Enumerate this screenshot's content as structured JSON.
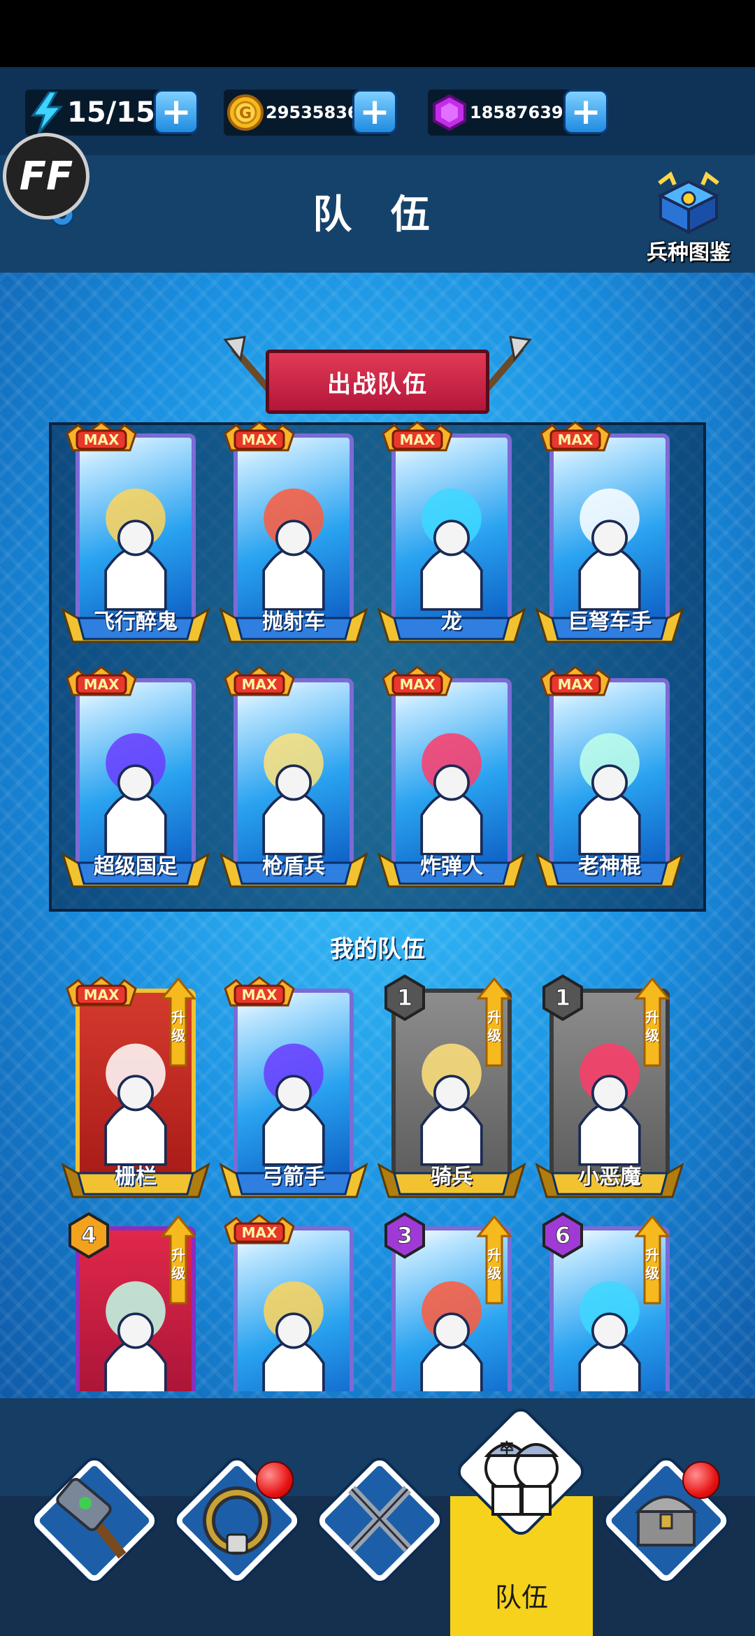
{
  "resources": {
    "energy": {
      "icon": "lightning-icon",
      "value": "15/15"
    },
    "gold": {
      "icon": "gold-coin-icon",
      "value": "29535836"
    },
    "gems": {
      "icon": "purple-gem-icon",
      "value": "18587639"
    },
    "plus_symbol": "+"
  },
  "header": {
    "ff_button": "FF",
    "title": "队 伍",
    "codex_label": "兵种图鉴"
  },
  "battle_team": {
    "ribbon_label": "出战队伍",
    "cards": [
      {
        "name": "飞行醉鬼",
        "badge": "MAX"
      },
      {
        "name": "抛射车",
        "badge": "MAX"
      },
      {
        "name": "龙",
        "badge": "MAX"
      },
      {
        "name": "巨弩车手",
        "badge": "MAX"
      },
      {
        "name": "超级国足",
        "badge": "MAX"
      },
      {
        "name": "枪盾兵",
        "badge": "MAX"
      },
      {
        "name": "炸弹人",
        "badge": "MAX"
      },
      {
        "name": "老神棍",
        "badge": "MAX"
      }
    ]
  },
  "my_team": {
    "title": "我的队伍",
    "upgrade_label": "升级",
    "cards": [
      {
        "name": "栅栏",
        "badge": "MAX",
        "upgrade": true
      },
      {
        "name": "弓箭手",
        "badge": "MAX",
        "upgrade": false
      },
      {
        "name": "骑兵",
        "badge": "1",
        "upgrade": true
      },
      {
        "name": "小恶魔",
        "badge": "1",
        "upgrade": true
      },
      {
        "name": "",
        "badge": "4",
        "upgrade": true
      },
      {
        "name": "",
        "badge": "MAX",
        "upgrade": false
      },
      {
        "name": "",
        "badge": "3",
        "upgrade": true
      },
      {
        "name": "",
        "badge": "6",
        "upgrade": true
      }
    ]
  },
  "bottom_nav": {
    "items": [
      {
        "icon": "hammer-icon",
        "notification": false
      },
      {
        "icon": "armor-ring-icon",
        "notification": true
      },
      {
        "icon": "crossed-swords-icon",
        "notification": false
      },
      {
        "icon": "soldiers-icon",
        "label": "队伍",
        "active": true,
        "helmet_text": "卒"
      },
      {
        "icon": "treasure-chest-icon",
        "notification": true
      }
    ]
  },
  "colors": {
    "active_tab": "#f6d21c",
    "plus_button": "#1f8be0",
    "ribbon": "#d32a48"
  }
}
